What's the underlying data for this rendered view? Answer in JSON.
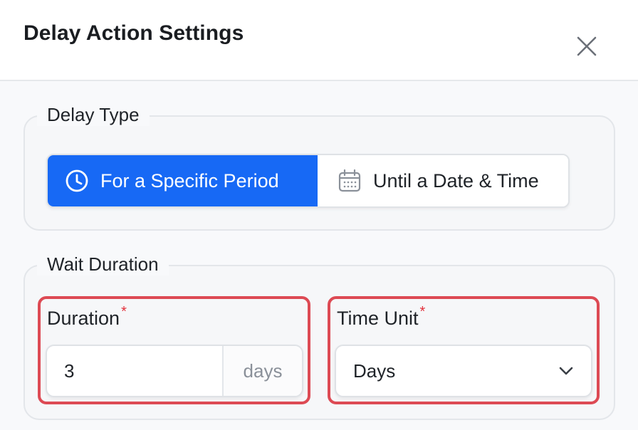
{
  "dialog": {
    "title": "Delay Action Settings"
  },
  "delay_type": {
    "legend": "Delay Type",
    "options": [
      {
        "label": "For a Specific Period",
        "icon": "clock-icon",
        "selected": true
      },
      {
        "label": "Until a Date & Time",
        "icon": "calendar-icon",
        "selected": false
      }
    ]
  },
  "wait_duration": {
    "legend": "Wait Duration",
    "duration": {
      "label": "Duration",
      "required_mark": "*",
      "value": "3",
      "suffix": "days"
    },
    "time_unit": {
      "label": "Time Unit",
      "required_mark": "*",
      "value": "Days"
    }
  },
  "colors": {
    "accent": "#1769f5",
    "highlight_border": "#dd4a54",
    "required": "#e2313c"
  }
}
